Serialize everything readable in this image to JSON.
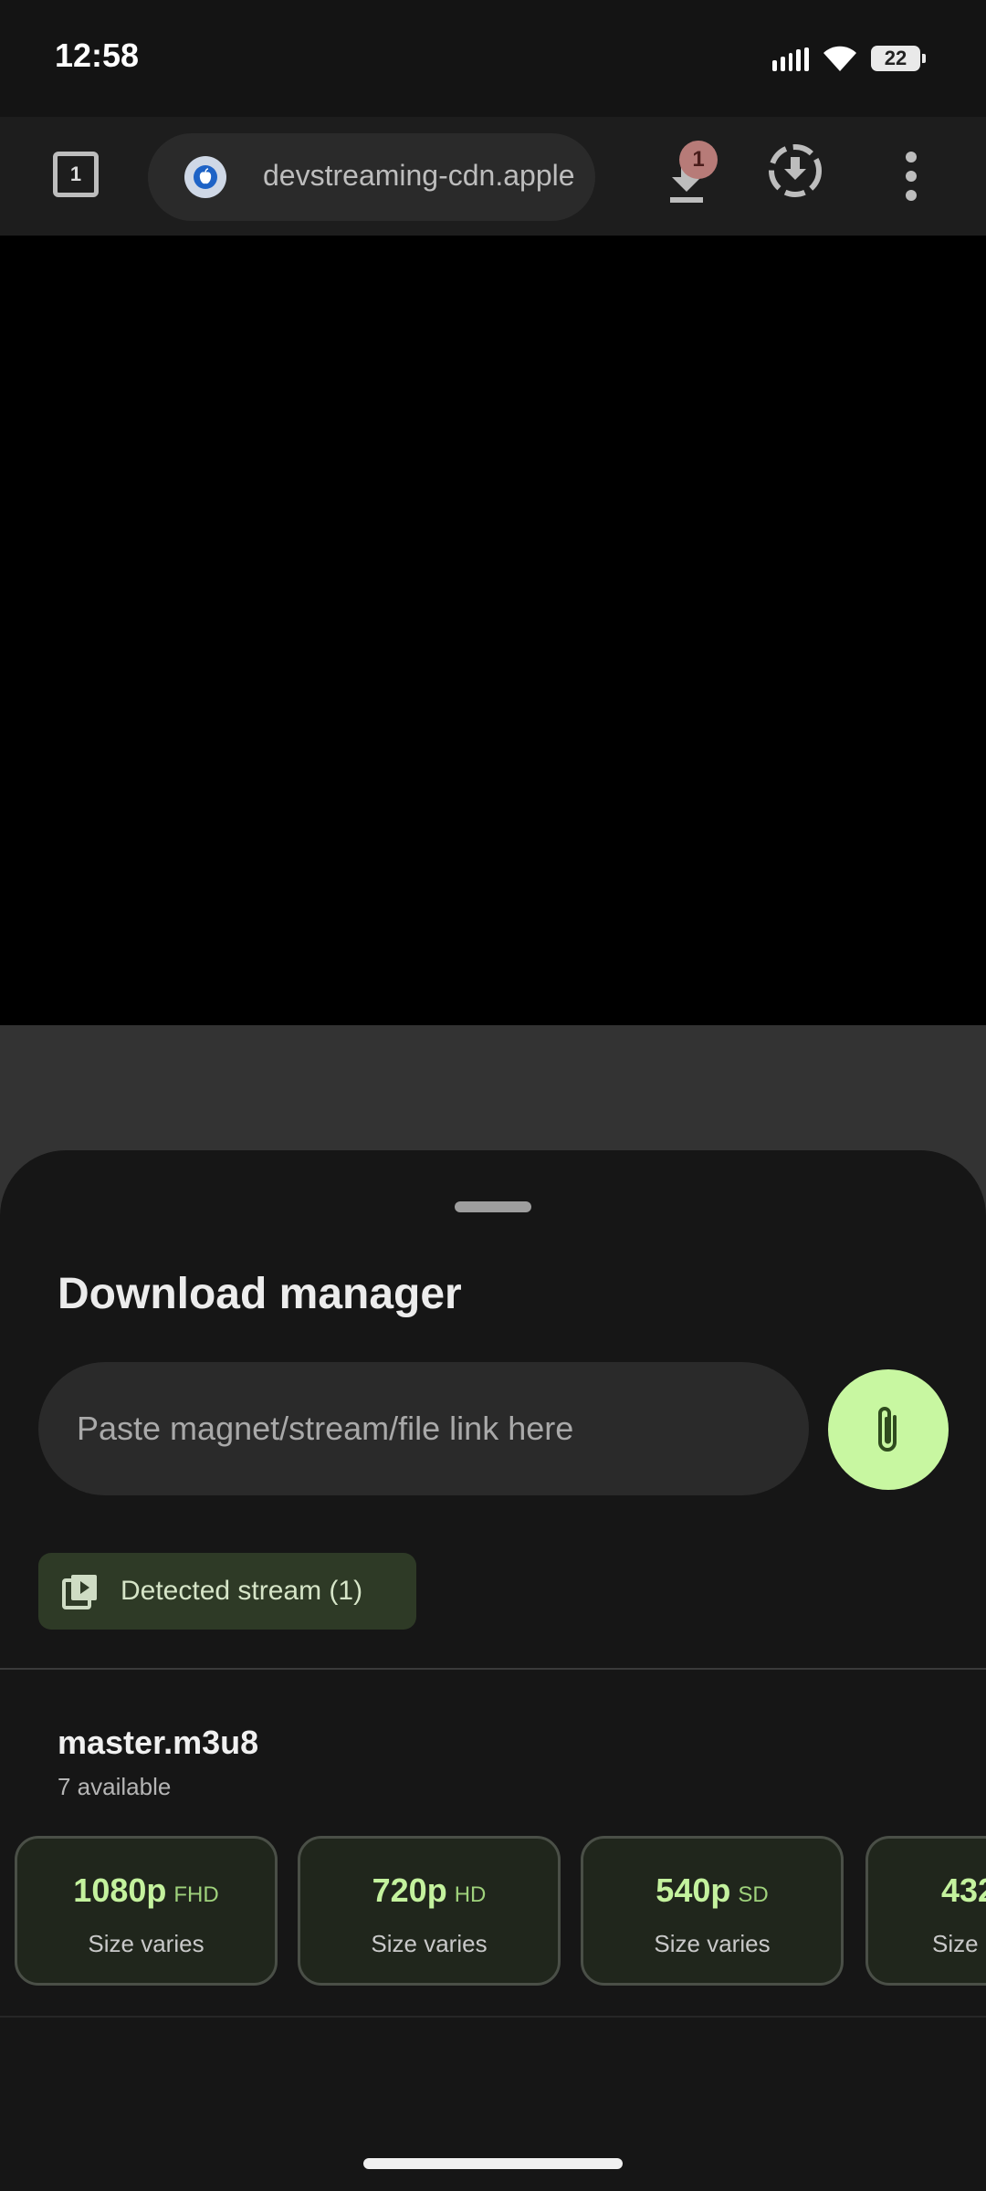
{
  "status_bar": {
    "time": "12:58",
    "battery": "22",
    "icons": [
      "signal-icon",
      "wifi-icon",
      "battery-icon"
    ]
  },
  "toolbar": {
    "tab_count": "1",
    "url": "devstreaming-cdn.apple",
    "download_badge": "1",
    "icons": [
      "tab-switcher-icon",
      "apple-logo-icon",
      "download-icon",
      "download-progress-icon",
      "more-vert-icon"
    ]
  },
  "sheet": {
    "title": "Download manager",
    "link_placeholder": "Paste magnet/stream/file link here",
    "paste_button_icon": "paperclip-icon",
    "detected_chip": {
      "icon": "video-library-icon",
      "label": "Detected stream (1)"
    },
    "file": {
      "name": "master.m3u8",
      "count": "7 available",
      "qualities": [
        {
          "resolution": "1080p",
          "tag": "FHD",
          "size": "Size varies"
        },
        {
          "resolution": "720p",
          "tag": "HD",
          "size": "Size varies"
        },
        {
          "resolution": "540p",
          "tag": "SD",
          "size": "Size varies"
        },
        {
          "resolution": "432",
          "tag": "",
          "size": "Size"
        }
      ]
    }
  },
  "colors": {
    "accent_green": "#c8f7a1",
    "chip_bg": "#2e3a26",
    "badge": "#b77b78"
  }
}
